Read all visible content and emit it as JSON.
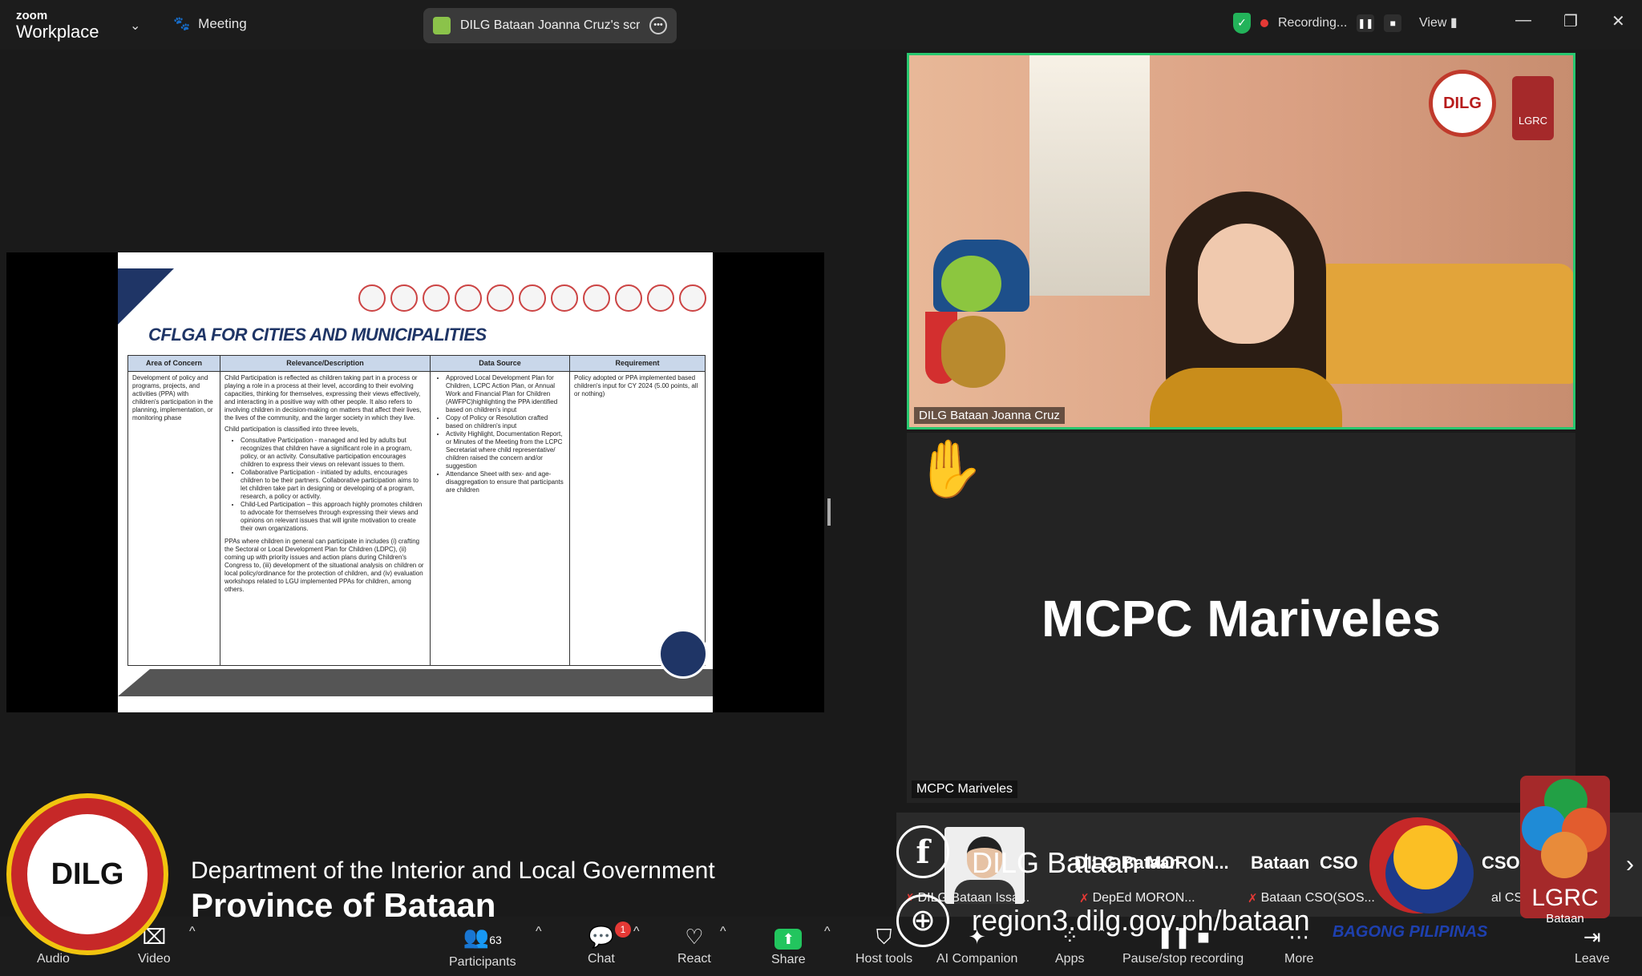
{
  "app": {
    "logo_small": "zoom",
    "logo_big": "Workplace"
  },
  "topbar": {
    "meeting_label": "Meeting",
    "share_pill_text": "DILG Bataan Joanna Cruz's screen",
    "recording_label": "Recording...",
    "view_label": "View"
  },
  "slide": {
    "title": "CFLGA FOR CITIES AND MUNICIPALITIES",
    "columns": [
      "Area of Concern",
      "Relevance/Description",
      "Data Source",
      "Requirement"
    ],
    "area": "Development of policy and programs, projects, and activities (PPA) with children's participation in the planning, implementation, or monitoring phase",
    "relevance_p1": "Child Participation is reflected as children taking part in a process or playing a role in a process at their level, according to their evolving capacities, thinking for themselves, expressing their views effectively, and interacting in a positive way with other people. It also refers to involving children in decision-making on matters that affect their lives, the lives of the community, and the larger society in which they live.",
    "relevance_p2": "Child participation is classified into three levels,",
    "relevance_levels": [
      "Consultative Participation - managed and led by adults but recognizes that children have a significant role in a program, policy, or an activity. Consultative participation encourages children to express their views on relevant issues to them.",
      "Collaborative Participation - initiated by adults, encourages children to be their partners. Collaborative participation aims to let children take part in designing or developing of a program, research, a policy or activity.",
      "Child-Led Participation – this approach highly promotes children to advocate for themselves through expressing their views and opinions on relevant issues that will ignite motivation to create their own organizations."
    ],
    "relevance_p3": "PPAs where children in general can participate in includes (i) crafting the Sectoral or Local Development Plan for Children (LDPC), (ii) coming up with priority issues and action plans during Children's Congress to, (iii) development of the situational analysis on children or local policy/ordinance for the protection of children, and (iv) evaluation workshops related to LGU implemented PPAs for children, among others.",
    "data_sources": [
      "Approved Local Development Plan for Children, LCPC Action Plan, or Annual Work and Financial Plan for Children (AWFPC)highlighting the PPA identified based on children's input",
      "Copy of Policy or Resolution crafted based on children's input",
      "Activity Highlight, Documentation Report, or Minutes of the Meeting from the LCPC Secretariat where child representative/ children raised the concern and/or suggestion",
      "Attendance Sheet with sex- and age-disaggregation to ensure that participants are children"
    ],
    "requirement": "Policy adopted or PPA implemented based children's input for CY 2024 (5.00 points, all or nothing)"
  },
  "video_tile": {
    "name": "DILG Bataan Joanna Cruz",
    "badge_text": "DILG",
    "lgrc_badge": "LGRC"
  },
  "name_tile": {
    "big_name": "MCPC Mariveles",
    "label": "MCPC Mariveles"
  },
  "strip": {
    "columns": [
      "DILG Bataan",
      "MORON...",
      "Bataan",
      "CSO",
      "CSO"
    ],
    "labels": [
      "DILG Bataan Issa...",
      "DepEd MORON...",
      "Bataan CSO(SOS...",
      "al CSO Er"
    ]
  },
  "toolbar": {
    "audio": "Audio",
    "video": "Video",
    "participants": "Participants",
    "participants_count": "63",
    "chat": "Chat",
    "chat_badge": "1",
    "react": "React",
    "share": "Share",
    "host_tools": "Host tools",
    "ai_companion": "AI Companion",
    "apps": "Apps",
    "pause_recording": "Pause/stop recording",
    "more": "More",
    "leave": "Leave"
  },
  "overlay": {
    "seal_text": "DILG",
    "line1": "Department of the Interior and Local Government",
    "line2": "Province of Bataan",
    "fb_name": "DILG Bataan",
    "website": "region3.dilg.gov.ph/bataan",
    "bagong": "BAGONG PILIPINAS",
    "lgrc_text": "LGRC",
    "lgrc_sub": "Bataan"
  },
  "colors": {
    "active_speaker": "#28c76f",
    "share_green": "#22c55e",
    "record_red": "#e53935",
    "slide_navy": "#1f3566"
  }
}
